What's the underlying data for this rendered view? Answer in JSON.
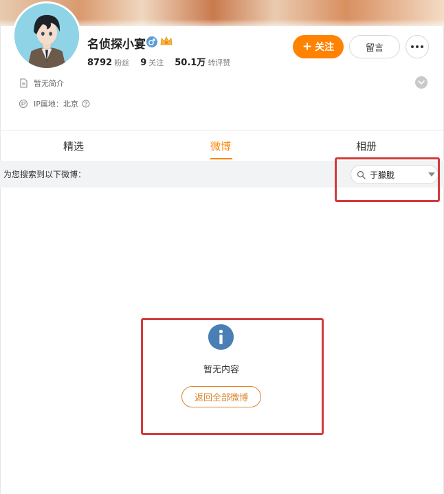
{
  "profile": {
    "name": "名侦探小宴",
    "gender_icon": "male-icon",
    "badge_icon": "vip-crown-icon",
    "stats": [
      {
        "num": "8792",
        "label": "粉丝"
      },
      {
        "num": "9",
        "label": "关注"
      },
      {
        "num": "50.1万",
        "label": "转评赞"
      }
    ],
    "bio": "暂无简介",
    "ip_location": "IP属地：北京"
  },
  "actions": {
    "follow_plus": "+",
    "follow_label": "关注",
    "message_label": "留言"
  },
  "tabs": [
    {
      "label": "精选",
      "active": false
    },
    {
      "label": "微博",
      "active": true
    },
    {
      "label": "相册",
      "active": false
    }
  ],
  "search": {
    "hint": "为您搜索到以下微博：",
    "keyword": "于朦胧"
  },
  "empty_state": {
    "icon": "info-icon",
    "message": "暂无内容",
    "back_button": "返回全部微博"
  },
  "colors": {
    "accent": "#ff8200",
    "annotation_red": "#d23b3b",
    "info_blue": "#4a7fb5"
  }
}
